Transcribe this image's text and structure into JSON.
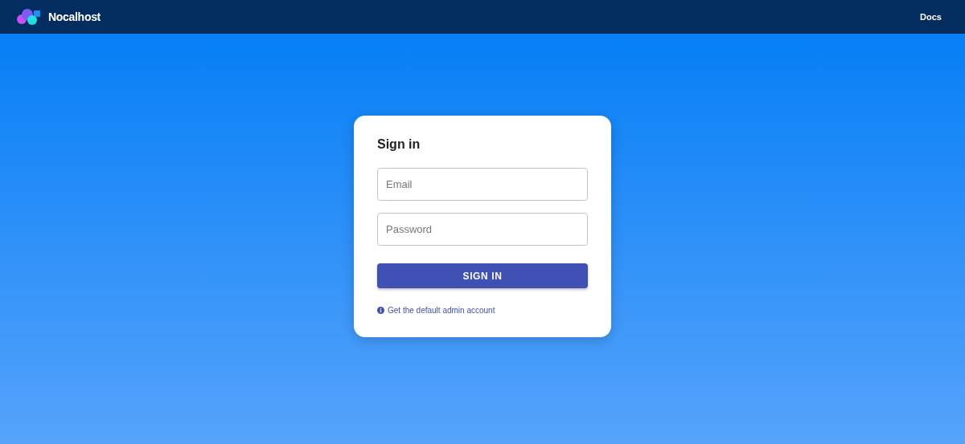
{
  "header": {
    "brand": "Nocalhost",
    "links": [
      "Docs"
    ]
  },
  "login": {
    "title": "Sign in",
    "fields": [
      {
        "placeholder": "Email"
      },
      {
        "placeholder": "Password"
      }
    ],
    "button": "SIGN IN",
    "help_link": "Get the default admin account"
  }
}
